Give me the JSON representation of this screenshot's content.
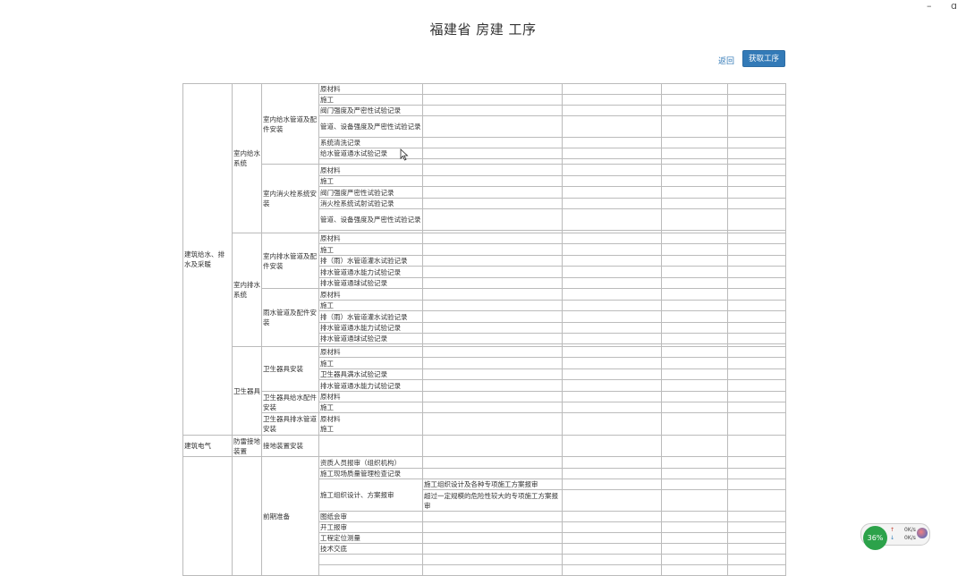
{
  "window": {
    "minimize_glyph": "–",
    "extra_glyph": "ɑ"
  },
  "title": "福建省 房建 工序",
  "actions": {
    "back_label": "返回",
    "fetch_label": "获取工序"
  },
  "widget": {
    "percent": "36%",
    "up_arrow": "↑",
    "down_arrow": "↓",
    "up_speed": "0K/s",
    "down_speed": "0K/s"
  },
  "table": {
    "col_widths": [
      55,
      33,
      64,
      116,
      156,
      111,
      74,
      65
    ],
    "rows": [
      {
        "h": 12,
        "cells": [
          {
            "text": "建筑给水、排水及采暖",
            "rowspan": 31
          },
          {
            "text": "室内给水系统",
            "rowspan": 13
          },
          {
            "text": "室内给水管道及配件安装",
            "rowspan": 7
          },
          {
            "text": "原材料"
          },
          {
            "text": ""
          },
          {
            "text": ""
          },
          {
            "text": ""
          },
          {
            "text": ""
          }
        ]
      },
      {
        "h": 12,
        "cells": [
          {
            "text": "施工"
          },
          {
            "text": ""
          },
          {
            "text": ""
          },
          {
            "text": ""
          },
          {
            "text": ""
          }
        ]
      },
      {
        "h": 12,
        "cells": [
          {
            "text": "阀门强度及严密性试验记录"
          },
          {
            "text": ""
          },
          {
            "text": ""
          },
          {
            "text": ""
          },
          {
            "text": ""
          }
        ]
      },
      {
        "h": 24,
        "cells": [
          {
            "text": "管道、设备强度及严密性试验记录"
          },
          {
            "text": ""
          },
          {
            "text": ""
          },
          {
            "text": ""
          },
          {
            "text": ""
          }
        ]
      },
      {
        "h": 12,
        "cells": [
          {
            "text": "系统清洗记录"
          },
          {
            "text": ""
          },
          {
            "text": ""
          },
          {
            "text": ""
          },
          {
            "text": ""
          }
        ]
      },
      {
        "h": 12,
        "cells": [
          {
            "text": "给水管道通水试验记录"
          },
          {
            "text": ""
          },
          {
            "text": ""
          },
          {
            "text": ""
          },
          {
            "text": ""
          }
        ]
      },
      {
        "h": 6,
        "cells": [
          {
            "text": ""
          },
          {
            "text": ""
          },
          {
            "text": ""
          },
          {
            "text": ""
          },
          {
            "text": ""
          }
        ]
      },
      {
        "h": 13,
        "cells": [
          {
            "text": "室内消火栓系统安装",
            "rowspan": 6
          },
          {
            "text": "原材料"
          },
          {
            "text": ""
          },
          {
            "text": ""
          },
          {
            "text": ""
          },
          {
            "text": ""
          }
        ]
      },
      {
        "h": 12,
        "cells": [
          {
            "text": "施工"
          },
          {
            "text": ""
          },
          {
            "text": ""
          },
          {
            "text": ""
          },
          {
            "text": ""
          }
        ]
      },
      {
        "h": 13,
        "cells": [
          {
            "text": "阀门强度严密性试验记录"
          },
          {
            "text": ""
          },
          {
            "text": ""
          },
          {
            "text": ""
          },
          {
            "text": ""
          }
        ]
      },
      {
        "h": 12,
        "cells": [
          {
            "text": "消火栓系统试射试验记录"
          },
          {
            "text": ""
          },
          {
            "text": ""
          },
          {
            "text": ""
          },
          {
            "text": ""
          }
        ]
      },
      {
        "h": 24,
        "cells": [
          {
            "text": "管道、设备强度及严密性试验记录"
          },
          {
            "text": ""
          },
          {
            "text": ""
          },
          {
            "text": ""
          },
          {
            "text": ""
          }
        ]
      },
      {
        "h": 3,
        "cells": [
          {
            "text": ""
          },
          {
            "text": ""
          },
          {
            "text": ""
          },
          {
            "text": ""
          },
          {
            "text": ""
          }
        ]
      },
      {
        "h": 12,
        "cells": [
          {
            "text": "室内排水系统",
            "rowspan": 11
          },
          {
            "text": "室内排水管道及配件安装",
            "rowspan": 5
          },
          {
            "text": "原材料"
          },
          {
            "text": ""
          },
          {
            "text": ""
          },
          {
            "text": ""
          },
          {
            "text": ""
          }
        ]
      },
      {
        "h": 13,
        "cells": [
          {
            "text": "施工"
          },
          {
            "text": ""
          },
          {
            "text": ""
          },
          {
            "text": ""
          },
          {
            "text": ""
          }
        ]
      },
      {
        "h": 12,
        "cells": [
          {
            "text": "排（雨）水管道灌水试验记录"
          },
          {
            "text": ""
          },
          {
            "text": ""
          },
          {
            "text": ""
          },
          {
            "text": ""
          }
        ]
      },
      {
        "h": 13,
        "cells": [
          {
            "text": "排水管道通水能力试验记录"
          },
          {
            "text": ""
          },
          {
            "text": ""
          },
          {
            "text": ""
          },
          {
            "text": ""
          }
        ]
      },
      {
        "h": 12,
        "cells": [
          {
            "text": "排水管道通球试验记录"
          },
          {
            "text": ""
          },
          {
            "text": ""
          },
          {
            "text": ""
          },
          {
            "text": ""
          }
        ]
      },
      {
        "h": 13,
        "cells": [
          {
            "text": "雨水管道及配件安装",
            "rowspan": 6
          },
          {
            "text": "原材料"
          },
          {
            "text": ""
          },
          {
            "text": ""
          },
          {
            "text": ""
          },
          {
            "text": ""
          }
        ]
      },
      {
        "h": 12,
        "cells": [
          {
            "text": "施工"
          },
          {
            "text": ""
          },
          {
            "text": ""
          },
          {
            "text": ""
          },
          {
            "text": ""
          }
        ]
      },
      {
        "h": 13,
        "cells": [
          {
            "text": "排（雨）水管道灌水试验记录"
          },
          {
            "text": ""
          },
          {
            "text": ""
          },
          {
            "text": ""
          },
          {
            "text": ""
          }
        ]
      },
      {
        "h": 12,
        "cells": [
          {
            "text": "排水管道通水能力试验记录"
          },
          {
            "text": ""
          },
          {
            "text": ""
          },
          {
            "text": ""
          },
          {
            "text": ""
          }
        ]
      },
      {
        "h": 12,
        "cells": [
          {
            "text": "排水管道通球试验记录"
          },
          {
            "text": ""
          },
          {
            "text": ""
          },
          {
            "text": ""
          },
          {
            "text": ""
          }
        ]
      },
      {
        "h": 3,
        "cells": [
          {
            "text": ""
          },
          {
            "text": ""
          },
          {
            "text": ""
          },
          {
            "text": ""
          },
          {
            "text": ""
          }
        ]
      },
      {
        "h": 12,
        "cells": [
          {
            "text": "卫生器具",
            "rowspan": 7
          },
          {
            "text": "卫生器具安装",
            "rowspan": 4
          },
          {
            "text": "原材料"
          },
          {
            "text": ""
          },
          {
            "text": ""
          },
          {
            "text": ""
          },
          {
            "text": ""
          }
        ]
      },
      {
        "h": 13,
        "cells": [
          {
            "text": "施工"
          },
          {
            "text": ""
          },
          {
            "text": ""
          },
          {
            "text": ""
          },
          {
            "text": ""
          }
        ]
      },
      {
        "h": 12,
        "cells": [
          {
            "text": "卫生器具满水试验记录"
          },
          {
            "text": ""
          },
          {
            "text": ""
          },
          {
            "text": ""
          },
          {
            "text": ""
          }
        ]
      },
      {
        "h": 13,
        "cells": [
          {
            "text": "排水管道通水能力试验记录"
          },
          {
            "text": ""
          },
          {
            "text": ""
          },
          {
            "text": ""
          },
          {
            "text": ""
          }
        ]
      },
      {
        "h": 12,
        "cells": [
          {
            "text": "卫生器具给水配件安装",
            "rowspan": 2
          },
          {
            "text": "原材料"
          },
          {
            "text": ""
          },
          {
            "text": ""
          },
          {
            "text": ""
          },
          {
            "text": ""
          }
        ]
      },
      {
        "h": 12,
        "cells": [
          {
            "text": "施工"
          },
          {
            "text": ""
          },
          {
            "text": ""
          },
          {
            "text": ""
          },
          {
            "text": ""
          }
        ]
      },
      {
        "h": 25,
        "cells": [
          {
            "text": "卫生器具排水管道安装"
          },
          {
            "text": "原材料\n施工"
          },
          {
            "text": ""
          },
          {
            "text": ""
          },
          {
            "text": ""
          },
          {
            "text": ""
          }
        ]
      },
      {
        "h": 24,
        "cells": [
          {
            "text": "建筑电气"
          },
          {
            "text": "防雷接地装置"
          },
          {
            "text": "接地装置安装"
          },
          {
            "text": ""
          },
          {
            "text": ""
          },
          {
            "text": ""
          },
          {
            "text": ""
          },
          {
            "text": ""
          }
        ]
      },
      {
        "h": 13,
        "cells": [
          {
            "text": "",
            "rowspan": 10
          },
          {
            "text": "",
            "rowspan": 10
          },
          {
            "text": "前期准备",
            "rowspan": 10
          },
          {
            "text": "资质人员报审（组织机构）"
          },
          {
            "text": ""
          },
          {
            "text": ""
          },
          {
            "text": ""
          },
          {
            "text": ""
          }
        ]
      },
      {
        "h": 12,
        "cells": [
          {
            "text": "施工现场质量管理检查记录"
          },
          {
            "text": ""
          },
          {
            "text": ""
          },
          {
            "text": ""
          },
          {
            "text": ""
          }
        ]
      },
      {
        "h": 12,
        "cells": [
          {
            "text": "施工组织设计、方案报审",
            "rowspan": 2
          },
          {
            "text": "施工组织设计及各种专项施工方案报审"
          },
          {
            "text": ""
          },
          {
            "text": ""
          },
          {
            "text": ""
          }
        ]
      },
      {
        "h": 24,
        "cells": [
          {
            "text": "超过一定规模的危险性较大的专项施工方案报审"
          },
          {
            "text": ""
          },
          {
            "text": ""
          },
          {
            "text": ""
          }
        ]
      },
      {
        "h": 12,
        "cells": [
          {
            "text": "图纸会审"
          },
          {
            "text": ""
          },
          {
            "text": ""
          },
          {
            "text": ""
          },
          {
            "text": ""
          }
        ]
      },
      {
        "h": 12,
        "cells": [
          {
            "text": "开工报审"
          },
          {
            "text": ""
          },
          {
            "text": ""
          },
          {
            "text": ""
          },
          {
            "text": ""
          }
        ]
      },
      {
        "h": 12,
        "cells": [
          {
            "text": "工程定位测量"
          },
          {
            "text": ""
          },
          {
            "text": ""
          },
          {
            "text": ""
          },
          {
            "text": ""
          }
        ]
      },
      {
        "h": 12,
        "cells": [
          {
            "text": "技术交底"
          },
          {
            "text": ""
          },
          {
            "text": ""
          },
          {
            "text": ""
          },
          {
            "text": ""
          }
        ]
      },
      {
        "h": 12,
        "cells": [
          {
            "text": ""
          },
          {
            "text": ""
          },
          {
            "text": ""
          },
          {
            "text": ""
          },
          {
            "text": ""
          }
        ]
      },
      {
        "h": 12,
        "cells": [
          {
            "text": ""
          },
          {
            "text": ""
          },
          {
            "text": ""
          },
          {
            "text": ""
          },
          {
            "text": ""
          }
        ]
      }
    ]
  }
}
